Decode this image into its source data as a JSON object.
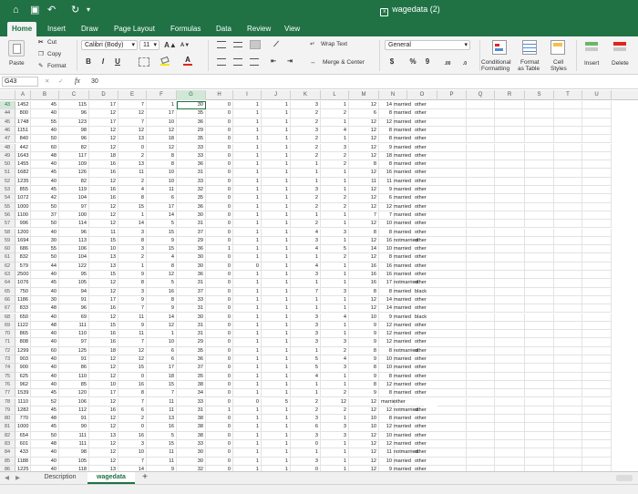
{
  "window": {
    "title": "wagedata (2)"
  },
  "quick_access": {
    "home": "⌂",
    "save": "▣",
    "undo": "↶",
    "redo": "↻",
    "more": "▾"
  },
  "tabs": [
    "Home",
    "Insert",
    "Draw",
    "Page Layout",
    "Formulas",
    "Data",
    "Review",
    "View"
  ],
  "active_tab": "Home",
  "ribbon": {
    "paste": "Paste",
    "cut": "Cut",
    "copy": "Copy",
    "format": "Format",
    "font_name": "Calibri (Body)",
    "font_size": "11",
    "bold": "B",
    "italic": "I",
    "underline": "U",
    "grow_font": "A▲",
    "shrink_font": "A▼",
    "font_color": "A",
    "wrap_text": "Wrap Text",
    "merge_center": "Merge & Center",
    "number_format": "General",
    "currency": "$",
    "percent": "%",
    "comma": "9",
    "inc_decimal": ".00",
    "dec_decimal": ".0",
    "conditional_formatting_1": "Conditional",
    "conditional_formatting_2": "Formatting",
    "format_as_table_1": "Format",
    "format_as_table_2": "as Table",
    "cell_styles_1": "Cell",
    "cell_styles_2": "Styles",
    "insert": "Insert",
    "delete": "Delete"
  },
  "formula_bar": {
    "name_box": "G43",
    "fx": "fx",
    "value": "30"
  },
  "columns": [
    "A",
    "B",
    "C",
    "D",
    "E",
    "F",
    "G",
    "H",
    "I",
    "J",
    "K",
    "L",
    "M",
    "N",
    "O",
    "P",
    "Q",
    "R",
    "S",
    "T",
    "U"
  ],
  "selected_column": "G",
  "rows": [
    {
      "n": "43",
      "v": [
        "1452",
        "45",
        "115",
        "17",
        "7",
        "1",
        "30",
        "0",
        "1",
        "1",
        "3",
        "1",
        "12",
        "14",
        "married",
        "other"
      ]
    },
    {
      "n": "44",
      "v": [
        "800",
        "40",
        "96",
        "12",
        "12",
        "17",
        "35",
        "0",
        "1",
        "1",
        "2",
        "2",
        "6",
        "8",
        "married",
        "other"
      ]
    },
    {
      "n": "45",
      "v": [
        "1748",
        "55",
        "123",
        "17",
        "7",
        "10",
        "36",
        "0",
        "1",
        "1",
        "2",
        "1",
        "12",
        "12",
        "married",
        "other"
      ]
    },
    {
      "n": "46",
      "v": [
        "1151",
        "40",
        "98",
        "12",
        "12",
        "12",
        "29",
        "0",
        "1",
        "1",
        "3",
        "4",
        "12",
        "8",
        "married",
        "other"
      ]
    },
    {
      "n": "47",
      "v": [
        "840",
        "50",
        "96",
        "12",
        "13",
        "18",
        "35",
        "0",
        "1",
        "1",
        "2",
        "1",
        "12",
        "8",
        "married",
        "other"
      ]
    },
    {
      "n": "48",
      "v": [
        "442",
        "60",
        "82",
        "12",
        "0",
        "12",
        "33",
        "0",
        "1",
        "1",
        "2",
        "3",
        "12",
        "9",
        "married",
        "other"
      ]
    },
    {
      "n": "49",
      "v": [
        "1643",
        "48",
        "117",
        "18",
        "2",
        "8",
        "33",
        "0",
        "1",
        "1",
        "2",
        "2",
        "12",
        "18",
        "married",
        "other"
      ]
    },
    {
      "n": "50",
      "v": [
        "1455",
        "40",
        "109",
        "16",
        "13",
        "8",
        "36",
        "0",
        "1",
        "1",
        "1",
        "2",
        "8",
        "8",
        "married",
        "other"
      ]
    },
    {
      "n": "51",
      "v": [
        "1682",
        "45",
        "126",
        "16",
        "11",
        "10",
        "31",
        "0",
        "1",
        "1",
        "1",
        "1",
        "12",
        "16",
        "married",
        "other"
      ]
    },
    {
      "n": "52",
      "v": [
        "1235",
        "40",
        "82",
        "12",
        "2",
        "10",
        "33",
        "0",
        "1",
        "1",
        "1",
        "1",
        "11",
        "11",
        "married",
        "other"
      ]
    },
    {
      "n": "53",
      "v": [
        "855",
        "45",
        "119",
        "16",
        "4",
        "11",
        "32",
        "0",
        "1",
        "1",
        "3",
        "1",
        "12",
        "9",
        "married",
        "other"
      ]
    },
    {
      "n": "54",
      "v": [
        "1072",
        "42",
        "104",
        "16",
        "8",
        "6",
        "35",
        "0",
        "1",
        "1",
        "2",
        "2",
        "12",
        "6",
        "married",
        "other"
      ]
    },
    {
      "n": "55",
      "v": [
        "1000",
        "50",
        "97",
        "12",
        "15",
        "17",
        "36",
        "0",
        "1",
        "1",
        "2",
        "2",
        "12",
        "12",
        "married",
        "other"
      ]
    },
    {
      "n": "56",
      "v": [
        "1100",
        "37",
        "100",
        "12",
        "1",
        "14",
        "30",
        "0",
        "1",
        "1",
        "1",
        "1",
        "7",
        "7",
        "married",
        "other"
      ]
    },
    {
      "n": "57",
      "v": [
        "996",
        "50",
        "114",
        "12",
        "14",
        "5",
        "31",
        "0",
        "1",
        "1",
        "2",
        "1",
        "12",
        "10",
        "married",
        "other"
      ]
    },
    {
      "n": "58",
      "v": [
        "1200",
        "40",
        "96",
        "11",
        "3",
        "15",
        "37",
        "0",
        "1",
        "1",
        "4",
        "3",
        "8",
        "8",
        "married",
        "other"
      ]
    },
    {
      "n": "59",
      "v": [
        "1694",
        "30",
        "113",
        "15",
        "8",
        "9",
        "29",
        "0",
        "1",
        "1",
        "3",
        "1",
        "12",
        "16",
        "notmarried",
        "other"
      ]
    },
    {
      "n": "60",
      "v": [
        "686",
        "55",
        "106",
        "10",
        "3",
        "15",
        "36",
        "1",
        "1",
        "1",
        "4",
        "5",
        "14",
        "10",
        "married",
        "other"
      ]
    },
    {
      "n": "61",
      "v": [
        "832",
        "50",
        "104",
        "13",
        "2",
        "4",
        "30",
        "0",
        "1",
        "1",
        "1",
        "2",
        "12",
        "8",
        "married",
        "other"
      ]
    },
    {
      "n": "62",
      "v": [
        "579",
        "44",
        "122",
        "13",
        "1",
        "8",
        "30",
        "0",
        "0",
        "1",
        "4",
        "1",
        "16",
        "16",
        "married",
        "other"
      ]
    },
    {
      "n": "63",
      "v": [
        "2500",
        "40",
        "95",
        "15",
        "9",
        "12",
        "36",
        "0",
        "1",
        "1",
        "3",
        "1",
        "16",
        "16",
        "married",
        "other"
      ]
    },
    {
      "n": "64",
      "v": [
        "1076",
        "45",
        "105",
        "12",
        "8",
        "5",
        "31",
        "0",
        "1",
        "1",
        "1",
        "1",
        "16",
        "17",
        "notmarried",
        "other"
      ]
    },
    {
      "n": "65",
      "v": [
        "750",
        "40",
        "94",
        "12",
        "3",
        "16",
        "37",
        "0",
        "1",
        "1",
        "7",
        "3",
        "8",
        "8",
        "married",
        "black"
      ]
    },
    {
      "n": "66",
      "v": [
        "1186",
        "30",
        "91",
        "17",
        "9",
        "8",
        "33",
        "0",
        "1",
        "1",
        "1",
        "1",
        "12",
        "14",
        "married",
        "other"
      ]
    },
    {
      "n": "67",
      "v": [
        "833",
        "48",
        "96",
        "16",
        "7",
        "9",
        "31",
        "0",
        "1",
        "1",
        "1",
        "1",
        "12",
        "14",
        "married",
        "other"
      ]
    },
    {
      "n": "68",
      "v": [
        "650",
        "40",
        "69",
        "12",
        "11",
        "14",
        "30",
        "0",
        "1",
        "1",
        "3",
        "4",
        "10",
        "9",
        "married",
        "black"
      ]
    },
    {
      "n": "69",
      "v": [
        "1122",
        "48",
        "111",
        "15",
        "9",
        "12",
        "31",
        "0",
        "1",
        "1",
        "3",
        "1",
        "9",
        "12",
        "married",
        "other"
      ]
    },
    {
      "n": "70",
      "v": [
        "865",
        "40",
        "110",
        "16",
        "11",
        "1",
        "31",
        "0",
        "1",
        "1",
        "3",
        "1",
        "9",
        "12",
        "married",
        "other"
      ]
    },
    {
      "n": "71",
      "v": [
        "808",
        "40",
        "97",
        "16",
        "7",
        "10",
        "29",
        "0",
        "1",
        "1",
        "3",
        "3",
        "9",
        "12",
        "married",
        "other"
      ]
    },
    {
      "n": "72",
      "v": [
        "1299",
        "60",
        "125",
        "18",
        "12",
        "6",
        "35",
        "0",
        "1",
        "1",
        "1",
        "2",
        "8",
        "8",
        "notmarried",
        "other"
      ]
    },
    {
      "n": "73",
      "v": [
        "903",
        "40",
        "91",
        "12",
        "12",
        "6",
        "36",
        "0",
        "1",
        "1",
        "5",
        "4",
        "9",
        "10",
        "married",
        "other"
      ]
    },
    {
      "n": "74",
      "v": [
        "900",
        "40",
        "86",
        "12",
        "15",
        "17",
        "37",
        "0",
        "1",
        "1",
        "5",
        "3",
        "8",
        "10",
        "married",
        "other"
      ]
    },
    {
      "n": "75",
      "v": [
        "625",
        "40",
        "110",
        "12",
        "0",
        "18",
        "35",
        "0",
        "1",
        "1",
        "4",
        "1",
        "9",
        "8",
        "married",
        "other"
      ]
    },
    {
      "n": "76",
      "v": [
        "962",
        "40",
        "85",
        "10",
        "16",
        "15",
        "38",
        "0",
        "1",
        "1",
        "1",
        "1",
        "8",
        "12",
        "married",
        "other"
      ]
    },
    {
      "n": "77",
      "v": [
        "1539",
        "45",
        "120",
        "17",
        "8",
        "7",
        "34",
        "0",
        "1",
        "1",
        "1",
        "2",
        "9",
        "8",
        "married",
        "other"
      ]
    },
    {
      "n": "78",
      "v": [
        "1110",
        "52",
        "106",
        "12",
        "7",
        "11",
        "33",
        "0",
        "0",
        "5",
        "2",
        "12",
        "12",
        "married",
        "other"
      ]
    },
    {
      "n": "79",
      "v": [
        "1282",
        "45",
        "112",
        "16",
        "6",
        "11",
        "31",
        "1",
        "1",
        "1",
        "2",
        "2",
        "12",
        "12",
        "notmarried",
        "other"
      ]
    },
    {
      "n": "80",
      "v": [
        "770",
        "48",
        "91",
        "12",
        "2",
        "13",
        "38",
        "0",
        "1",
        "1",
        "3",
        "1",
        "10",
        "8",
        "married",
        "other"
      ]
    },
    {
      "n": "81",
      "v": [
        "1000",
        "45",
        "90",
        "12",
        "0",
        "16",
        "38",
        "0",
        "1",
        "1",
        "6",
        "3",
        "10",
        "12",
        "married",
        "other"
      ]
    },
    {
      "n": "82",
      "v": [
        "654",
        "50",
        "111",
        "13",
        "16",
        "5",
        "38",
        "0",
        "1",
        "1",
        "3",
        "3",
        "12",
        "10",
        "married",
        "other"
      ]
    },
    {
      "n": "83",
      "v": [
        "601",
        "48",
        "111",
        "12",
        "3",
        "15",
        "33",
        "0",
        "1",
        "1",
        "0",
        "1",
        "12",
        "12",
        "married",
        "other"
      ]
    },
    {
      "n": "84",
      "v": [
        "433",
        "40",
        "98",
        "12",
        "10",
        "11",
        "30",
        "0",
        "1",
        "1",
        "1",
        "1",
        "12",
        "11",
        "notmarried",
        "other"
      ]
    },
    {
      "n": "85",
      "v": [
        "1188",
        "40",
        "105",
        "12",
        "7",
        "11",
        "30",
        "0",
        "1",
        "1",
        "3",
        "1",
        "12",
        "10",
        "married",
        "other"
      ]
    },
    {
      "n": "86",
      "v": [
        "1225",
        "40",
        "118",
        "13",
        "14",
        "9",
        "32",
        "0",
        "1",
        "1",
        "0",
        "1",
        "12",
        "9",
        "married",
        "other"
      ]
    }
  ],
  "sheets": [
    "Description",
    "wagedata"
  ],
  "active_sheet": "wagedata",
  "add_sheet": "+",
  "colors": {
    "accent": "#207245"
  }
}
